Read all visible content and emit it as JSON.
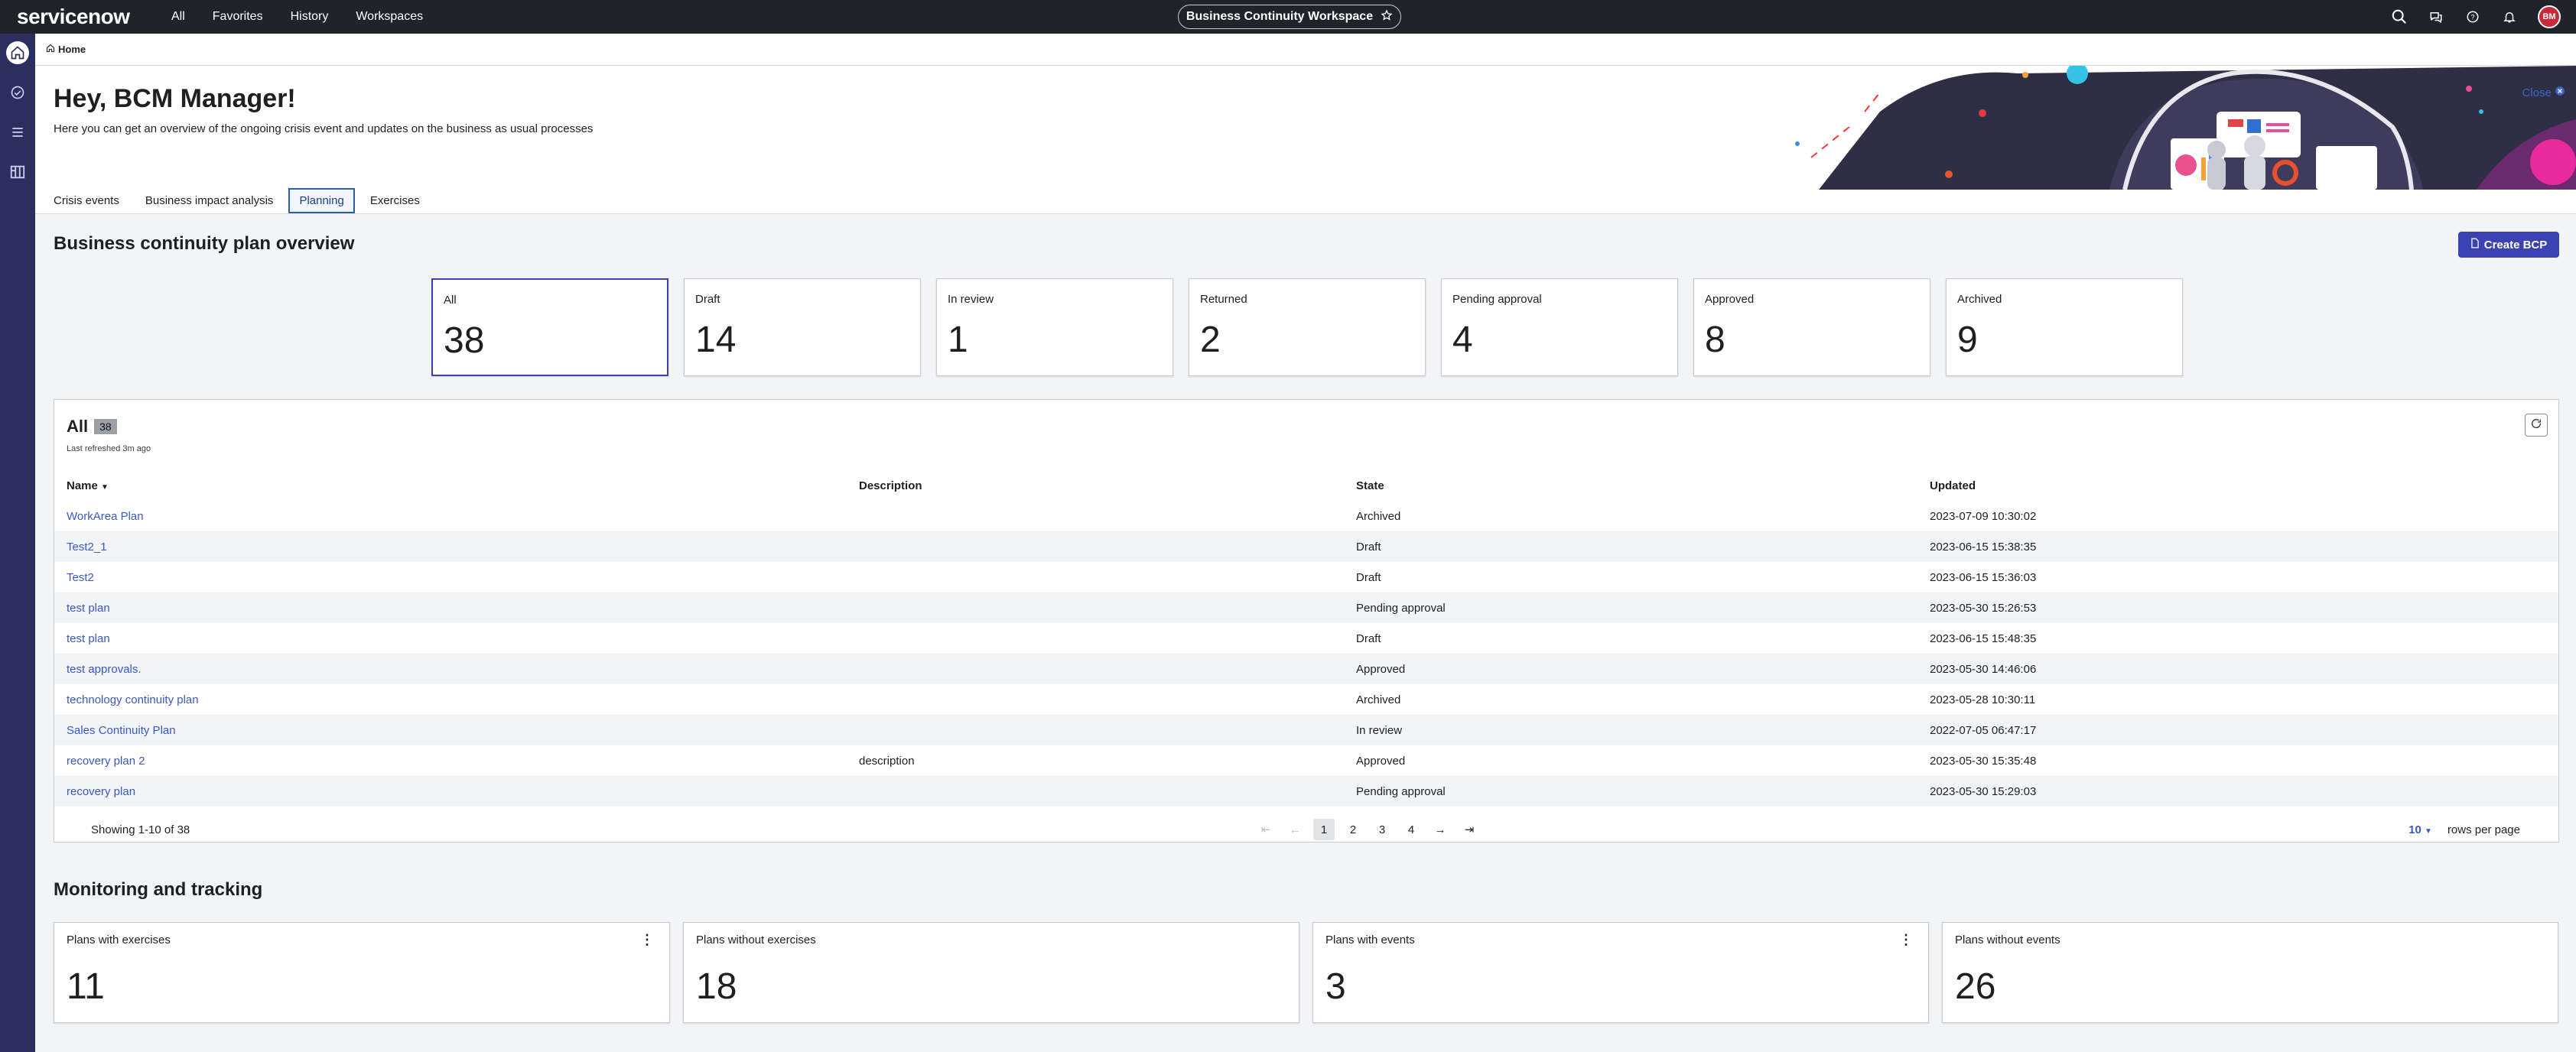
{
  "topnav": {
    "logo": "servicenow",
    "menu": [
      "All",
      "Favorites",
      "History",
      "Workspaces"
    ],
    "workspace_title": "Business Continuity Workspace",
    "icons": [
      "search-icon",
      "chat-icon",
      "help-icon",
      "bell-icon"
    ],
    "avatar_initials": "BM"
  },
  "sidebar": {
    "icons": [
      "home-icon",
      "check-circle-icon",
      "list-icon",
      "board-icon"
    ]
  },
  "breadcrumb": {
    "home": "Home"
  },
  "hero": {
    "greeting": "Hey, BCM Manager!",
    "subtitle": "Here you can get an overview of the ongoing crisis event and updates on the business as usual processes",
    "close_label": "Close"
  },
  "tabs": [
    "Crisis events",
    "Business impact analysis",
    "Planning",
    "Exercises"
  ],
  "overview": {
    "title": "Business continuity plan overview",
    "create_label": "Create BCP",
    "stats": [
      {
        "label": "All",
        "value": "38"
      },
      {
        "label": "Draft",
        "value": "14"
      },
      {
        "label": "In review",
        "value": "1"
      },
      {
        "label": "Returned",
        "value": "2"
      },
      {
        "label": "Pending approval",
        "value": "4"
      },
      {
        "label": "Approved",
        "value": "8"
      },
      {
        "label": "Archived",
        "value": "9"
      }
    ]
  },
  "list": {
    "title": "All",
    "count": "38",
    "refreshed": "Last refreshed 3m ago",
    "columns": [
      "Name",
      "Description",
      "State",
      "Updated"
    ],
    "rows": [
      {
        "name": "WorkArea Plan",
        "description": "",
        "state": "Archived",
        "updated": "2023-07-09 10:30:02"
      },
      {
        "name": "Test2_1",
        "description": "",
        "state": "Draft",
        "updated": "2023-06-15 15:38:35"
      },
      {
        "name": "Test2",
        "description": "",
        "state": "Draft",
        "updated": "2023-06-15 15:36:03"
      },
      {
        "name": "test plan",
        "description": "",
        "state": "Pending approval",
        "updated": "2023-05-30 15:26:53"
      },
      {
        "name": "test plan",
        "description": "",
        "state": "Draft",
        "updated": "2023-06-15 15:48:35"
      },
      {
        "name": "test approvals.",
        "description": "",
        "state": "Approved",
        "updated": "2023-05-30 14:46:06"
      },
      {
        "name": "technology continuity plan",
        "description": "",
        "state": "Archived",
        "updated": "2023-05-28 10:30:11"
      },
      {
        "name": "Sales Continuity Plan",
        "description": "",
        "state": "In review",
        "updated": "2022-07-05 06:47:17"
      },
      {
        "name": "recovery plan 2",
        "description": "description",
        "state": "Approved",
        "updated": "2023-05-30 15:35:48"
      },
      {
        "name": "recovery plan",
        "description": "",
        "state": "Pending approval",
        "updated": "2023-05-30 15:29:03"
      }
    ],
    "showing": "Showing 1-10 of 38",
    "pages": [
      "1",
      "2",
      "3",
      "4"
    ],
    "current_page": "1",
    "rows_per_page": "10",
    "rows_per_page_label": "rows per page"
  },
  "monitoring": {
    "title": "Monitoring and tracking",
    "cards": [
      {
        "label": "Plans with exercises",
        "value": "11",
        "menu": true
      },
      {
        "label": "Plans without exercises",
        "value": "18",
        "menu": false
      },
      {
        "label": "Plans with events",
        "value": "3",
        "menu": true
      },
      {
        "label": "Plans without events",
        "value": "26",
        "menu": false
      }
    ]
  },
  "colors": {
    "accent": "#3b43b3",
    "nav": "#20232a",
    "rail": "#2b2f5f",
    "link": "#3a58c8"
  }
}
